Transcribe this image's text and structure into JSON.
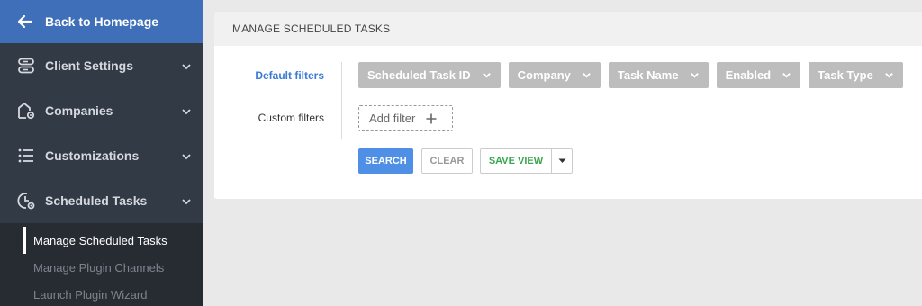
{
  "sidebar": {
    "back_label": "Back to Homepage",
    "items": [
      {
        "label": "Client Settings",
        "icon": "database-icon"
      },
      {
        "label": "Companies",
        "icon": "building-gear-icon"
      },
      {
        "label": "Customizations",
        "icon": "list-icon"
      },
      {
        "label": "Scheduled Tasks",
        "icon": "clock-gear-icon"
      }
    ],
    "submenu": [
      {
        "label": "Manage Scheduled Tasks",
        "active": true
      },
      {
        "label": "Manage Plugin Channels",
        "active": false
      },
      {
        "label": "Launch Plugin Wizard",
        "active": false
      }
    ]
  },
  "main": {
    "title": "MANAGE SCHEDULED TASKS",
    "default_filters_label": "Default filters",
    "custom_filters_label": "Custom filters",
    "filters": [
      {
        "label": "Scheduled Task ID"
      },
      {
        "label": "Company"
      },
      {
        "label": "Task Name"
      },
      {
        "label": "Enabled"
      },
      {
        "label": "Task Type"
      }
    ],
    "add_filter_label": "Add filter",
    "buttons": {
      "search": "SEARCH",
      "clear": "CLEAR",
      "save_view": "SAVE VIEW"
    }
  },
  "colors": {
    "sidebar_bg": "#323a45",
    "back_bg": "#3f6fb8",
    "accent_blue": "#4f8fe6",
    "save_green": "#3aa652",
    "chip_gray": "#bdbdbd"
  }
}
